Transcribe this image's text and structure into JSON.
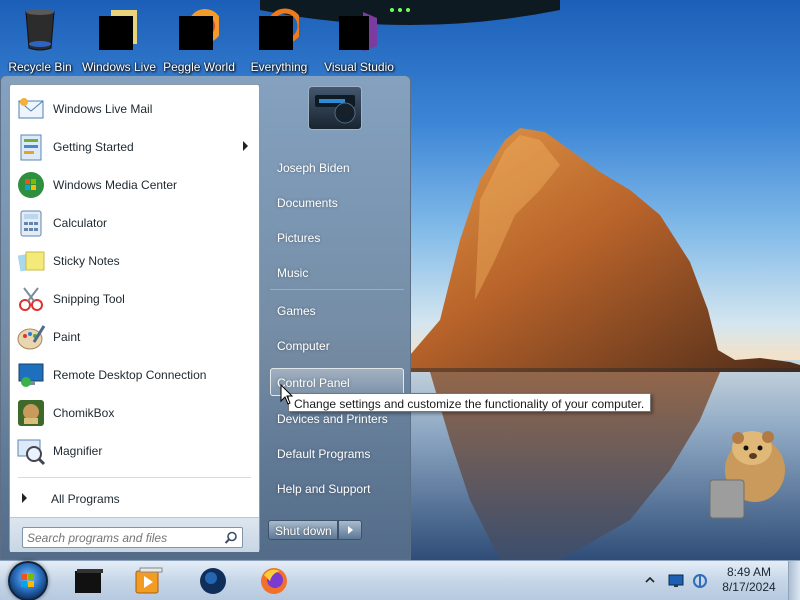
{
  "desktop": {
    "icons": [
      {
        "label": "Recycle Bin",
        "icon": "recycle-bin-icon"
      },
      {
        "label": "Windows Live",
        "icon": "windows-live-icon"
      },
      {
        "label": "Peggle World",
        "icon": "peggle-world-icon"
      },
      {
        "label": "Everything",
        "icon": "everything-icon"
      },
      {
        "label": "Visual Studio",
        "icon": "visual-studio-icon"
      }
    ]
  },
  "start_menu": {
    "programs": [
      {
        "label": "Windows Live Mail",
        "icon": "mail-icon"
      },
      {
        "label": "Getting Started",
        "icon": "getting-started-icon",
        "submenu": true
      },
      {
        "label": "Windows Media Center",
        "icon": "media-center-icon"
      },
      {
        "label": "Calculator",
        "icon": "calculator-icon"
      },
      {
        "label": "Sticky Notes",
        "icon": "sticky-notes-icon"
      },
      {
        "label": "Snipping Tool",
        "icon": "snipping-tool-icon"
      },
      {
        "label": "Paint",
        "icon": "paint-icon"
      },
      {
        "label": "Remote Desktop Connection",
        "icon": "remote-desktop-icon"
      },
      {
        "label": "ChomikBox",
        "icon": "chomikbox-icon"
      },
      {
        "label": "Magnifier",
        "icon": "magnifier-icon"
      }
    ],
    "all_programs": "All Programs",
    "search_placeholder": "Search programs and files",
    "right_items": [
      {
        "label": "Joseph Biden"
      },
      {
        "label": "Documents"
      },
      {
        "label": "Pictures"
      },
      {
        "label": "Music"
      },
      {
        "label": "Games"
      },
      {
        "label": "Computer"
      },
      {
        "label": "Control Panel",
        "hovered": true
      },
      {
        "label": "Devices and Printers"
      },
      {
        "label": "Default Programs"
      },
      {
        "label": "Help and Support"
      }
    ],
    "shutdown_label": "Shut down",
    "tooltip": "Change settings and customize the functionality of your computer."
  },
  "taskbar": {
    "apps": [
      {
        "icon": "black-app-icon"
      },
      {
        "icon": "media-player-icon"
      },
      {
        "icon": "globe-icon"
      },
      {
        "icon": "firefox-icon"
      }
    ],
    "time": "8:49 AM",
    "date": "8/17/2024"
  },
  "colors": {
    "menu_left_bg": "#ffffff",
    "menu_glass": "#6f88a6",
    "taskbar": "#c6d6e8"
  }
}
